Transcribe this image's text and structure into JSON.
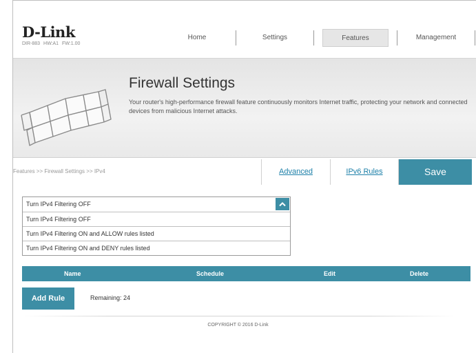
{
  "brand": {
    "logo": "D-Link",
    "model": "DIR-883",
    "hw": "HW:A1",
    "fw": "FW:1.00"
  },
  "nav": {
    "items": [
      {
        "label": "Home"
      },
      {
        "label": "Settings"
      },
      {
        "label": "Features",
        "active": true
      },
      {
        "label": "Management"
      }
    ]
  },
  "banner": {
    "title": "Firewall Settings",
    "description": "Your router's high-performance firewall feature continuously monitors Internet traffic, protecting your network and connected devices from malicious Internet attacks."
  },
  "breadcrumb": "Features >> Firewall Settings >> IPv4",
  "tabs": {
    "advanced": "Advanced",
    "ipv6_rules": "IPv6 Rules",
    "save": "Save"
  },
  "filter_select": {
    "selected": "Turn IPv4 Filtering OFF",
    "options": [
      "Turn IPv4 Filtering OFF",
      "Turn IPv4 Filtering ON and ALLOW rules listed",
      "Turn IPv4 Filtering ON and DENY rules listed"
    ]
  },
  "rules_table": {
    "columns": [
      "Name",
      "Schedule",
      "Edit",
      "Delete"
    ]
  },
  "add_rule": {
    "label": "Add Rule",
    "remaining": "Remaining: 24"
  },
  "footer": {
    "copyright": "COPYRIGHT © 2016 D-Link"
  },
  "colors": {
    "accent": "#3d8ea5",
    "link": "#1b7fa8"
  }
}
